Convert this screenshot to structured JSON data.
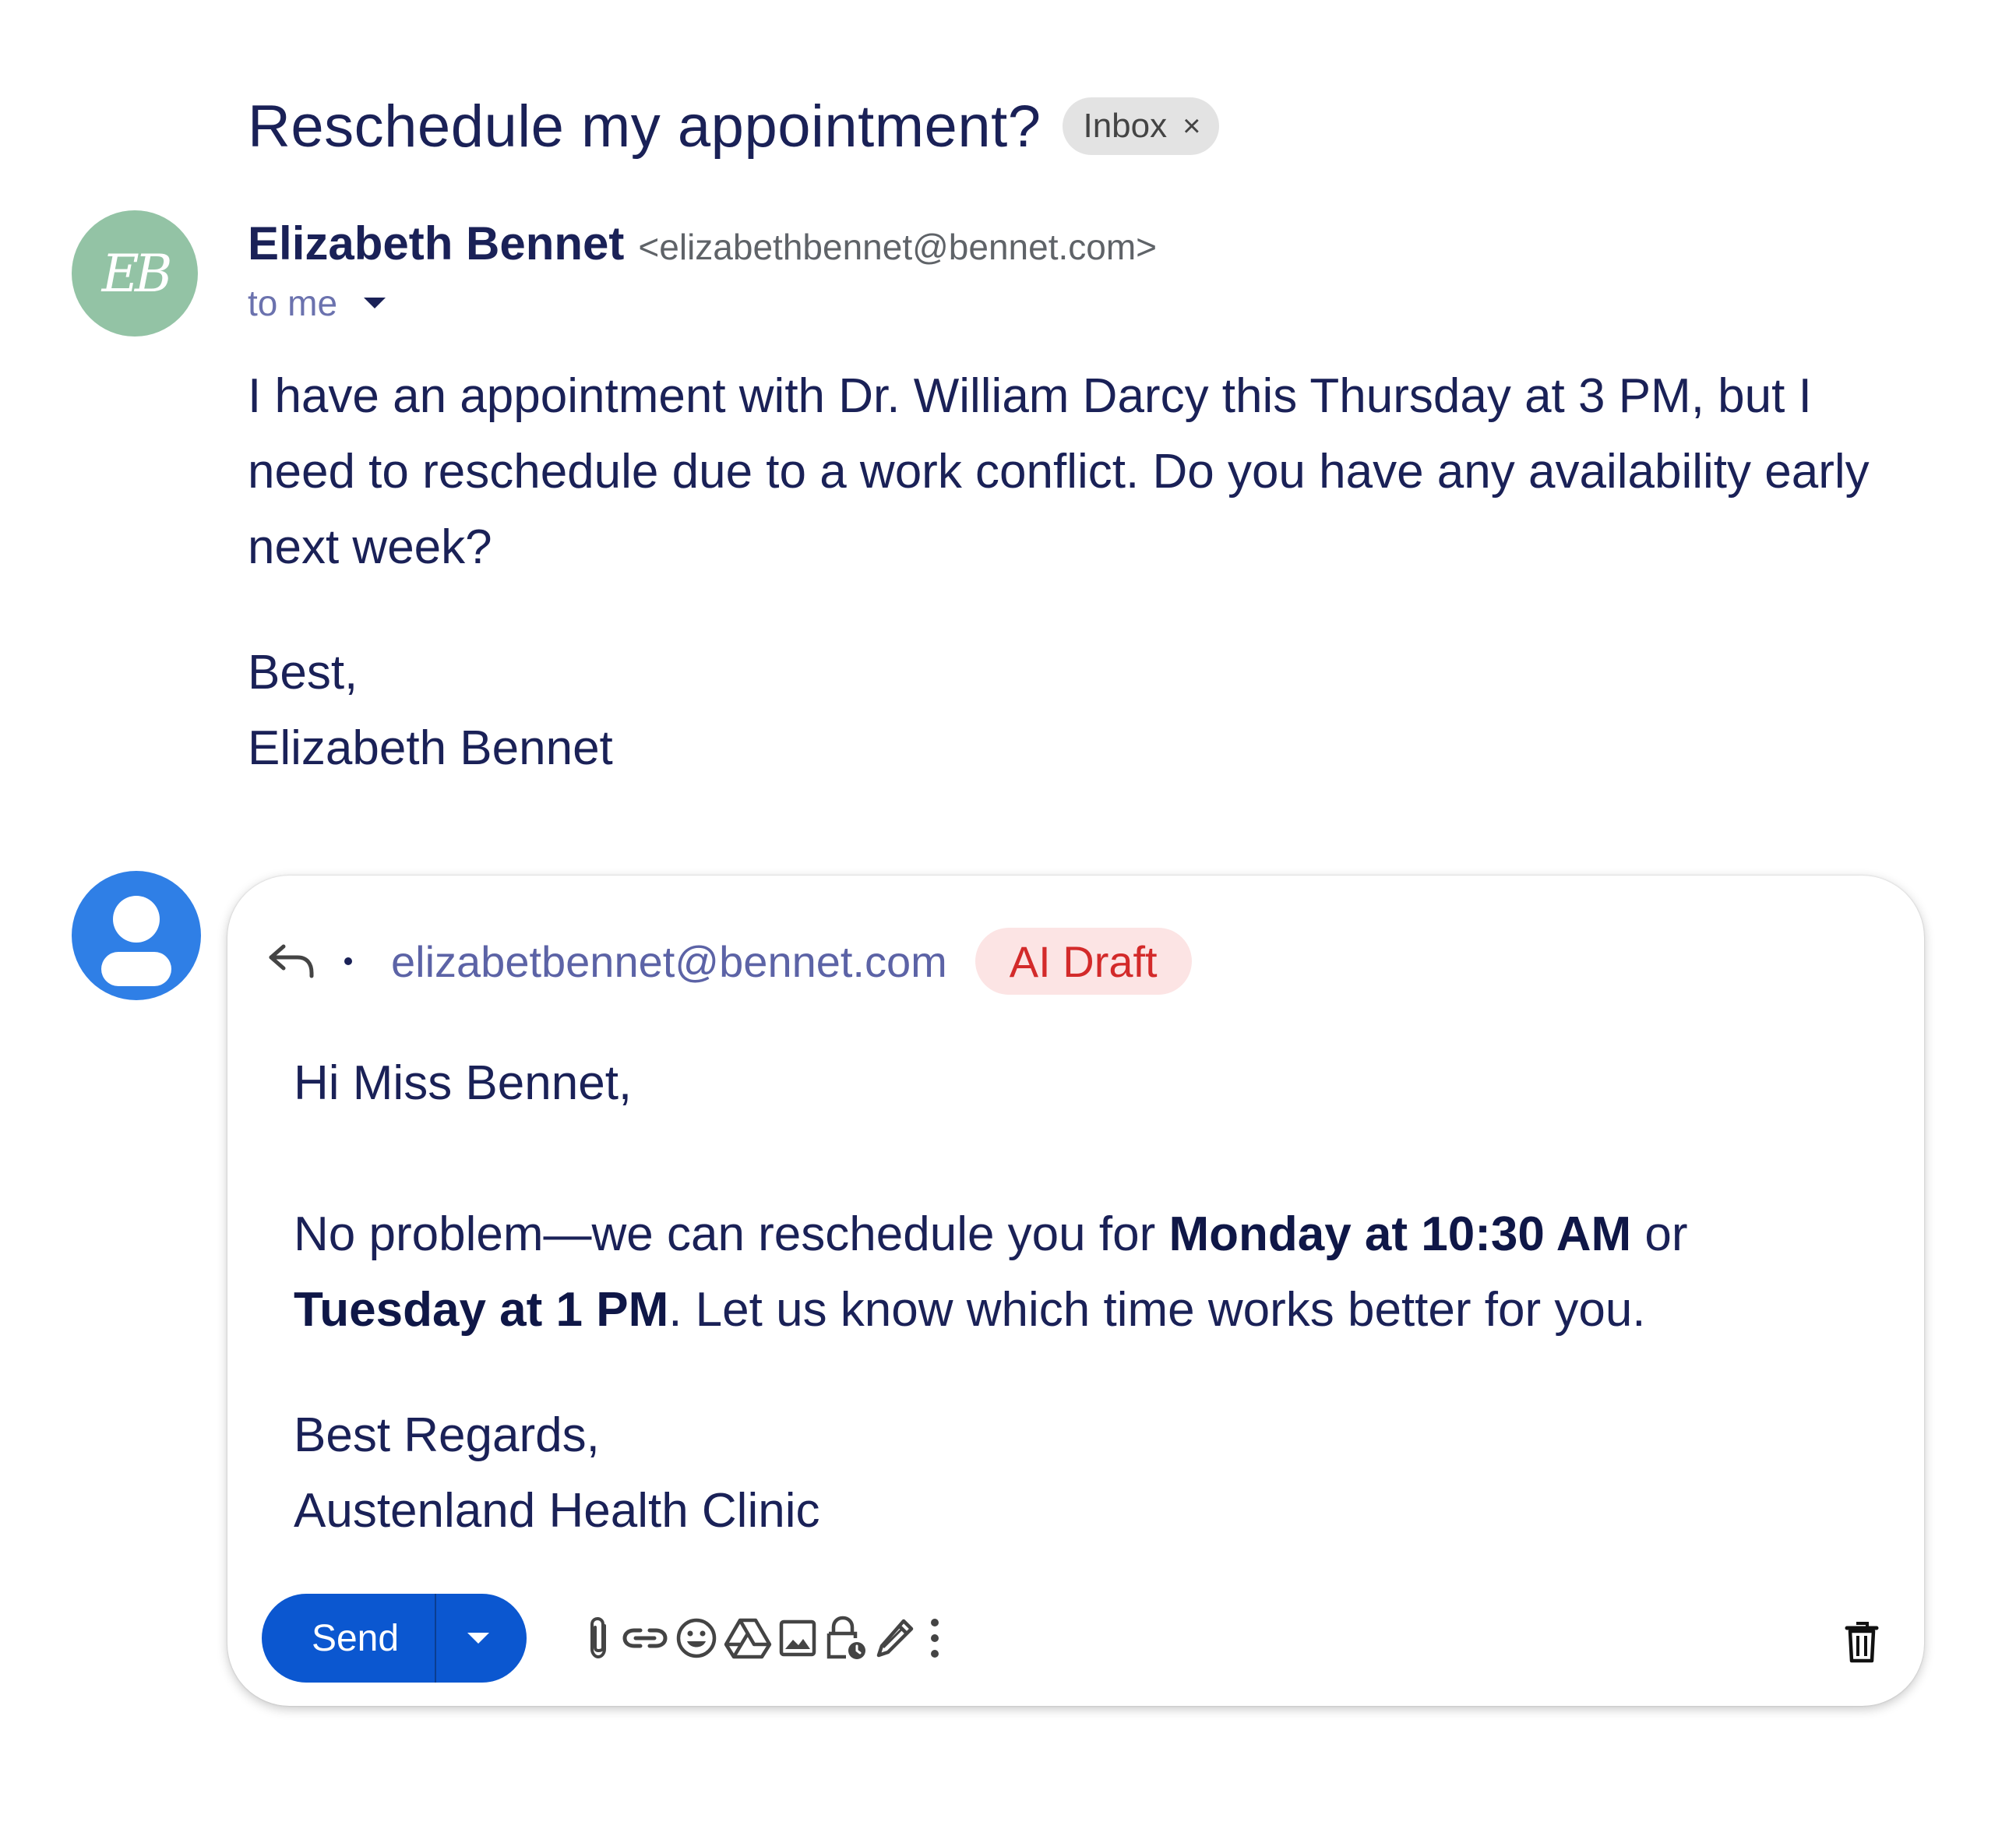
{
  "thread": {
    "subject": "Reschedule my appointment?",
    "label_chip": "Inbox",
    "label_chip_remove": "×"
  },
  "message": {
    "avatar_initials": "EB",
    "avatar_color": "#93c3a5",
    "sender_name": "Elizabeth Bennet",
    "sender_email": "<elizabethbennet@bennet.com>",
    "recipient": "to me",
    "body_paragraph": "I have an appointment with Dr. William Darcy this Thursday at 3 PM, but I need to reschedule due to a work conflict. Do you have any availability early next week?",
    "signoff": "Best,",
    "signature": "Elizabeth Bennet"
  },
  "reply": {
    "avatar_color": "#2f7fe6",
    "to_email": "elizabetbennet@bennet.com",
    "draft_badge": "AI Draft",
    "greeting": "Hi Miss Bennet,",
    "body_part1": "No problem—we can reschedule you for ",
    "body_bold1": "Monday at 10:30 AM",
    "body_part2": " or ",
    "body_bold2": "Tuesday at 1 PM",
    "body_part3": ". Let us know which time works better for you.",
    "signoff": "Best Regards,",
    "signature": "Austenland Health Clinic",
    "send_label": "Send",
    "toolbar_icons": [
      "attach-icon",
      "link-icon",
      "emoji-icon",
      "drive-icon",
      "photo-icon",
      "confidential-icon",
      "signature-icon",
      "more-options-icon",
      "trash-icon"
    ]
  },
  "colors": {
    "text_primary": "#1a2157",
    "link_blue": "#5c63a6",
    "send_button": "#0b57d0",
    "ai_badge_bg": "#fce4e4",
    "ai_badge_text": "#d32a2a"
  }
}
